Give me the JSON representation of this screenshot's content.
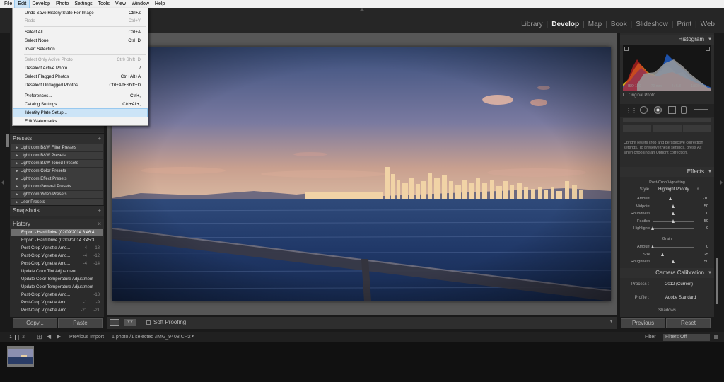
{
  "menubar": {
    "items": [
      "File",
      "Edit",
      "Develop",
      "Photo",
      "Settings",
      "Tools",
      "View",
      "Window",
      "Help"
    ]
  },
  "edit_menu": {
    "items": [
      {
        "label": "Undo Save History State For Image",
        "shortcut": "Ctrl+Z"
      },
      {
        "label": "Redo",
        "shortcut": "Ctrl+Y"
      },
      {
        "label": "Select All",
        "shortcut": "Ctrl+A"
      },
      {
        "label": "Select None",
        "shortcut": "Ctrl+D"
      },
      {
        "label": "Invert Selection",
        "shortcut": ""
      },
      {
        "label": "Select Only Active Photo",
        "shortcut": "Ctrl+Shift+D"
      },
      {
        "label": "Deselect Active Photo",
        "shortcut": "/"
      },
      {
        "label": "Select Flagged Photos",
        "shortcut": "Ctrl+Alt+A"
      },
      {
        "label": "Deselect Unflagged Photos",
        "shortcut": "Ctrl+Alt+Shift+D"
      },
      {
        "label": "Preferences...",
        "shortcut": "Ctrl+,"
      },
      {
        "label": "Catalog Settings...",
        "shortcut": "Ctrl+Alt+,"
      },
      {
        "label": "Identity Plate Setup...",
        "shortcut": ""
      },
      {
        "label": "Edit Watermarks...",
        "shortcut": ""
      }
    ]
  },
  "modules": {
    "items": [
      "Library",
      "Develop",
      "Map",
      "Book",
      "Slideshow",
      "Print",
      "Web"
    ],
    "active": "Develop"
  },
  "left_panel": {
    "presets_title": "Presets",
    "presets": [
      "Lightroom B&W Filter Presets",
      "Lightroom B&W Presets",
      "Lightroom B&W Toned Presets",
      "Lightroom Color Presets",
      "Lightroom Effect Presets",
      "Lightroom General Presets",
      "Lightroom Video Presets",
      "User Presets"
    ],
    "snapshots_title": "Snapshots",
    "history_title": "History",
    "history": [
      {
        "label": "Export - Hard Drive (02/09/2014 8:46:4...",
        "old": "",
        "value": ""
      },
      {
        "label": "Export - Hard Drive (02/09/2014 8:45:3...",
        "old": "",
        "value": ""
      },
      {
        "label": "Post-Crop Vignette Amo...",
        "old": "-4",
        "value": "-18"
      },
      {
        "label": "Post-Crop Vignette Amo...",
        "old": "-4",
        "value": "-12"
      },
      {
        "label": "Post-Crop Vignette Amo...",
        "old": "-4",
        "value": "-14"
      },
      {
        "label": "Update Color Tint Adjustment",
        "old": "",
        "value": ""
      },
      {
        "label": "Update Color Temperature Adjustment",
        "old": "",
        "value": ""
      },
      {
        "label": "Update Color Temperature Adjustment",
        "old": "",
        "value": ""
      },
      {
        "label": "Post-Crop Vignette Amo...",
        "old": "",
        "value": "-18"
      },
      {
        "label": "Post-Crop Vignette Amo...",
        "old": "-1",
        "value": "-9"
      },
      {
        "label": "Post-Crop Vignette Amo...",
        "old": "-21",
        "value": "-21"
      }
    ],
    "copy_label": "Copy...",
    "paste_label": "Paste"
  },
  "toolbar": {
    "yy_label": "YY",
    "soft_proofing": "Soft Proofing"
  },
  "right_panel": {
    "histogram_title": "Histogram",
    "camera_info": [
      "ISO 100",
      "70 mm",
      "f / 6.3",
      "1/320 sec"
    ],
    "original_photo": "Original Photo",
    "upright_note": "Upright resets crop and perspective correction settings. To preserve these settings, press Alt when choosing an Upright correction.",
    "effects_title": "Effects",
    "vignette_title": "Post-Crop Vignetting",
    "style_label": "Style",
    "style_value": "Highlight Priority",
    "vignette_sliders": [
      {
        "label": "Amount",
        "value": "-10",
        "pos": 0.44
      },
      {
        "label": "Midpoint",
        "value": "50",
        "pos": 0.5
      },
      {
        "label": "Roundness",
        "value": "0",
        "pos": 0.5
      },
      {
        "label": "Feather",
        "value": "50",
        "pos": 0.5
      },
      {
        "label": "Highlights",
        "value": "0",
        "pos": 0.0
      }
    ],
    "grain_title": "Grain",
    "grain_sliders": [
      {
        "label": "Amount",
        "value": "0",
        "pos": 0.0
      },
      {
        "label": "Size",
        "value": "25",
        "pos": 0.25
      },
      {
        "label": "Roughness",
        "value": "50",
        "pos": 0.5
      }
    ],
    "calibration_title": "Camera Calibration",
    "process_label": "Process :",
    "process_value": "2012 (Current)",
    "profile_label": "Profile :",
    "profile_value": "Adobe Standard",
    "shadows_label": "Shadows",
    "previous_label": "Previous",
    "reset_label": "Reset"
  },
  "filmstrip": {
    "page1": "1",
    "page2": "2",
    "source": "Previous Import",
    "info": "1 photo /1 selected /IMG_9408.CR2",
    "filter_label": "Filter :",
    "filter_value": "Filters Off"
  },
  "colors": {
    "menu_highlight": "#cce4f7",
    "panel_bg": "#2b2b2b",
    "workspace_bg": "#575757"
  }
}
